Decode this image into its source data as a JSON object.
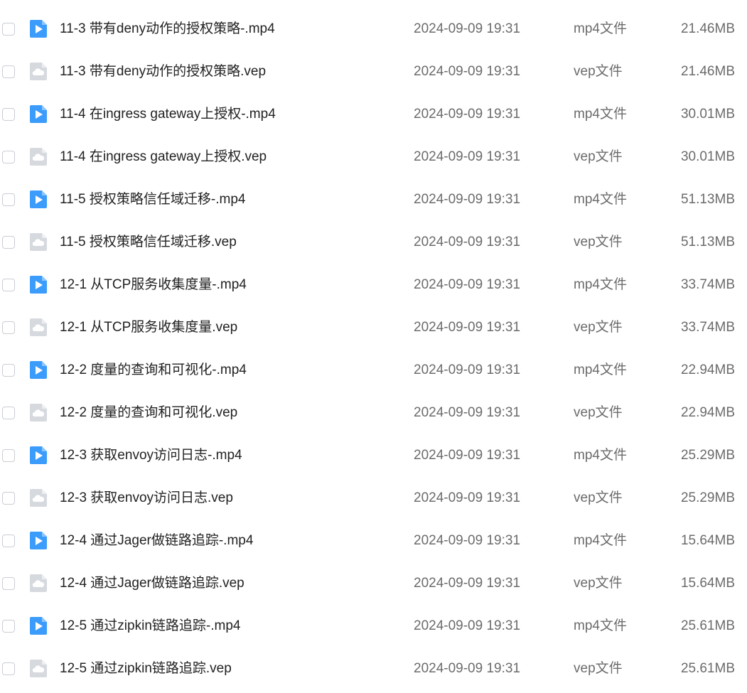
{
  "colors": {
    "video_icon": "#3b9cfb",
    "vep_icon": "#d6d9de",
    "checkbox_border": "#c9cdd4"
  },
  "files": [
    {
      "name": "11-3 带有deny动作的授权策略-.mp4",
      "date": "2024-09-09 19:31",
      "type": "mp4文件",
      "size": "21.46MB",
      "icon": "video-file-icon"
    },
    {
      "name": "11-3 带有deny动作的授权策略.vep",
      "date": "2024-09-09 19:31",
      "type": "vep文件",
      "size": "21.46MB",
      "icon": "cloud-file-icon"
    },
    {
      "name": "11-4 在ingress gateway上授权-.mp4",
      "date": "2024-09-09 19:31",
      "type": "mp4文件",
      "size": "30.01MB",
      "icon": "video-file-icon"
    },
    {
      "name": "11-4 在ingress gateway上授权.vep",
      "date": "2024-09-09 19:31",
      "type": "vep文件",
      "size": "30.01MB",
      "icon": "cloud-file-icon"
    },
    {
      "name": "11-5 授权策略信任域迁移-.mp4",
      "date": "2024-09-09 19:31",
      "type": "mp4文件",
      "size": "51.13MB",
      "icon": "video-file-icon"
    },
    {
      "name": "11-5 授权策略信任域迁移.vep",
      "date": "2024-09-09 19:31",
      "type": "vep文件",
      "size": "51.13MB",
      "icon": "cloud-file-icon"
    },
    {
      "name": "12-1 从TCP服务收集度量-.mp4",
      "date": "2024-09-09 19:31",
      "type": "mp4文件",
      "size": "33.74MB",
      "icon": "video-file-icon"
    },
    {
      "name": "12-1 从TCP服务收集度量.vep",
      "date": "2024-09-09 19:31",
      "type": "vep文件",
      "size": "33.74MB",
      "icon": "cloud-file-icon"
    },
    {
      "name": "12-2 度量的查询和可视化-.mp4",
      "date": "2024-09-09 19:31",
      "type": "mp4文件",
      "size": "22.94MB",
      "icon": "video-file-icon"
    },
    {
      "name": "12-2 度量的查询和可视化.vep",
      "date": "2024-09-09 19:31",
      "type": "vep文件",
      "size": "22.94MB",
      "icon": "cloud-file-icon"
    },
    {
      "name": "12-3 获取envoy访问日志-.mp4",
      "date": "2024-09-09 19:31",
      "type": "mp4文件",
      "size": "25.29MB",
      "icon": "video-file-icon"
    },
    {
      "name": "12-3 获取envoy访问日志.vep",
      "date": "2024-09-09 19:31",
      "type": "vep文件",
      "size": "25.29MB",
      "icon": "cloud-file-icon"
    },
    {
      "name": "12-4 通过Jager做链路追踪-.mp4",
      "date": "2024-09-09 19:31",
      "type": "mp4文件",
      "size": "15.64MB",
      "icon": "video-file-icon"
    },
    {
      "name": "12-4 通过Jager做链路追踪.vep",
      "date": "2024-09-09 19:31",
      "type": "vep文件",
      "size": "15.64MB",
      "icon": "cloud-file-icon"
    },
    {
      "name": "12-5 通过zipkin链路追踪-.mp4",
      "date": "2024-09-09 19:31",
      "type": "mp4文件",
      "size": "25.61MB",
      "icon": "video-file-icon"
    },
    {
      "name": "12-5 通过zipkin链路追踪.vep",
      "date": "2024-09-09 19:31",
      "type": "vep文件",
      "size": "25.61MB",
      "icon": "cloud-file-icon"
    }
  ]
}
